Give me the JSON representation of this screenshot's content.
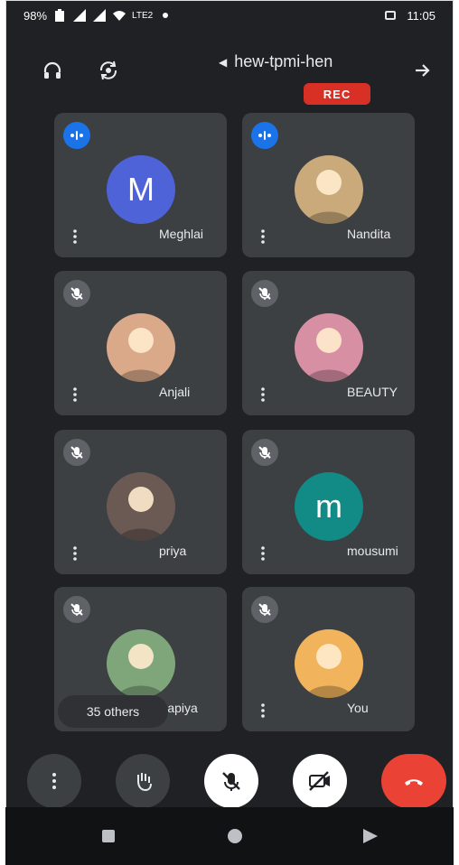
{
  "status": {
    "battery_pct": "98%",
    "network": "LTE2",
    "time": "11:05"
  },
  "meeting": {
    "name": "hew-tpmi-hen",
    "rec_label": "REC"
  },
  "participants": [
    {
      "name": "Nandita",
      "speaking": true,
      "avatar": "photo",
      "bg": "#caa97a"
    },
    {
      "name": "Meghlai",
      "speaking": true,
      "avatar": "letter",
      "initial": "M",
      "bg": "#4f63d8"
    },
    {
      "name": "BEAUTY",
      "speaking": false,
      "avatar": "photo",
      "bg": "#d78fa4"
    },
    {
      "name": "Anjali",
      "speaking": false,
      "avatar": "photo",
      "bg": "#d9a98a"
    },
    {
      "name": "mousumi",
      "speaking": false,
      "avatar": "letter",
      "initial": "m",
      "bg": "#128a86"
    },
    {
      "name": "priya",
      "speaking": false,
      "avatar": "photo",
      "bg": "#6b5a54"
    },
    {
      "name": "You",
      "speaking": false,
      "avatar": "photo",
      "bg": "#f1b45d"
    },
    {
      "name": "Papiya",
      "speaking": false,
      "avatar": "photo",
      "bg": "#7fa67a"
    }
  ],
  "others": {
    "label": "35 others"
  },
  "colors": {
    "background": "#202124",
    "tile": "#3c4043",
    "speaking_blue": "#1a73e8",
    "rec_red": "#d93025",
    "end_call_red": "#ea4335"
  },
  "icons": {
    "headphones": "headphones-icon",
    "camera_switch": "camera-switch-icon",
    "back_arrow": "arrow-right-icon",
    "mic_off": "mic-off-icon",
    "speaking": "speaking-icon",
    "more": "more-vertical-icon",
    "hand": "raise-hand-icon",
    "video_off": "video-off-icon",
    "end_call": "end-call-icon"
  }
}
